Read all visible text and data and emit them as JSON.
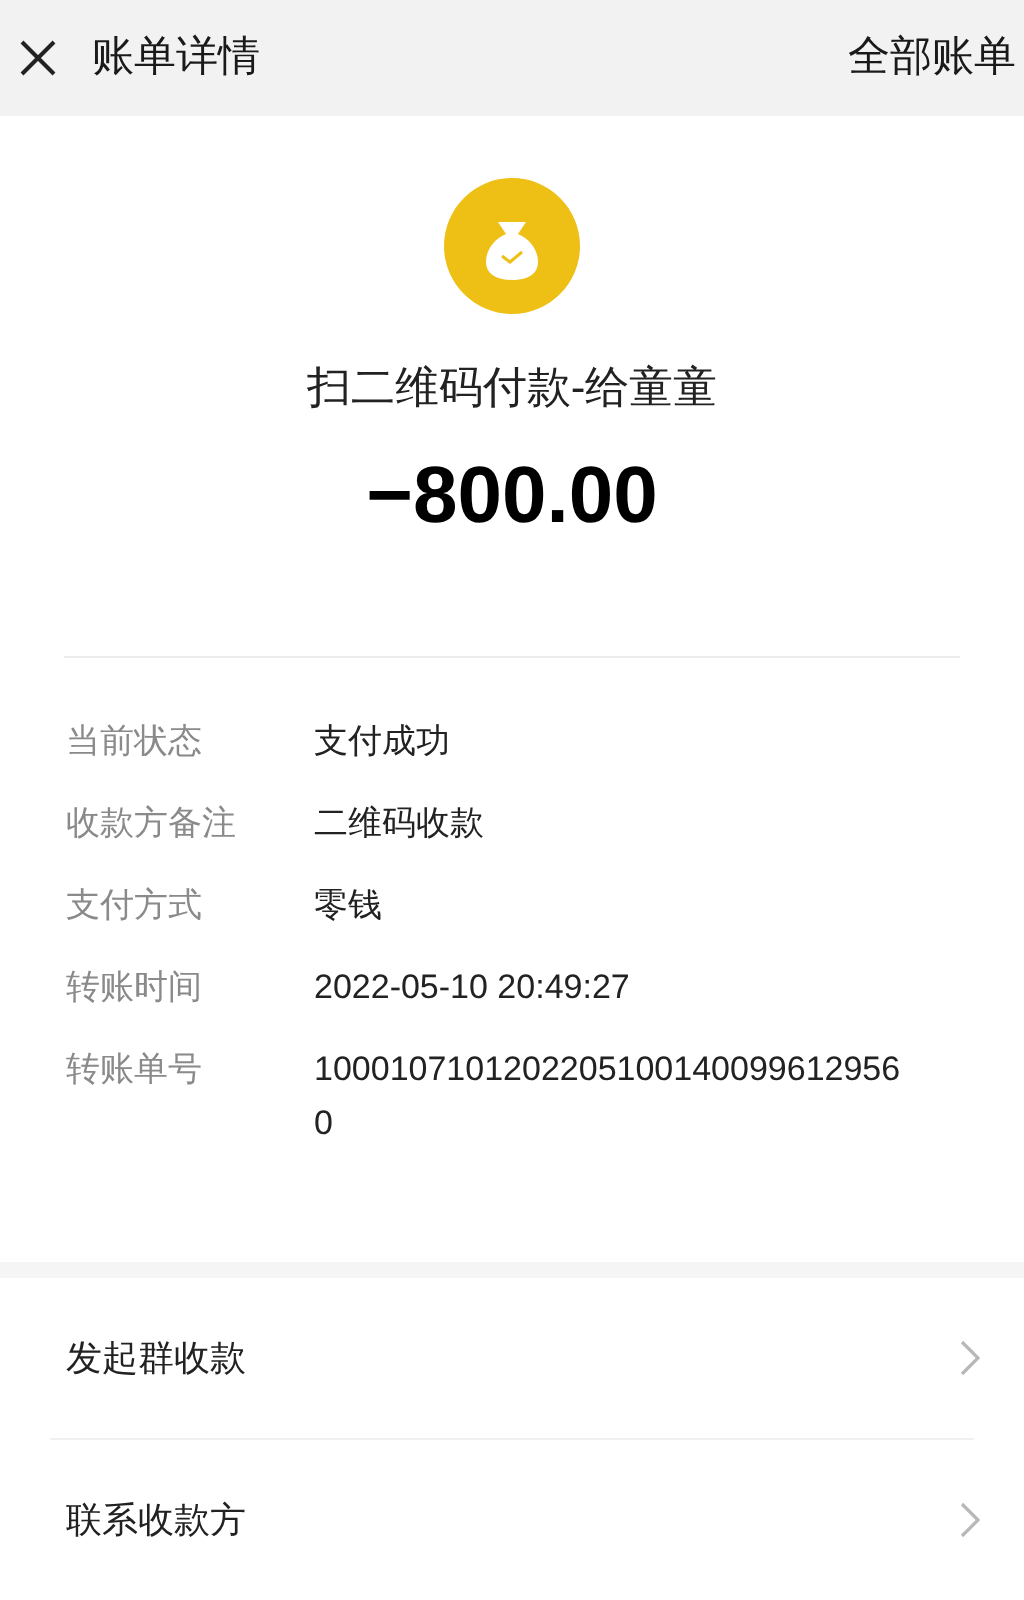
{
  "header": {
    "title": "账单详情",
    "action": "全部账单"
  },
  "summary": {
    "title": "扫二维码付款-给童童",
    "amount": "−800.00"
  },
  "details": [
    {
      "label": "当前状态",
      "value": "支付成功"
    },
    {
      "label": "收款方备注",
      "value": "二维码收款"
    },
    {
      "label": "支付方式",
      "value": "零钱"
    },
    {
      "label": "转账时间",
      "value": "2022-05-10 20:49:27"
    },
    {
      "label": "转账单号",
      "value": "10001071012022051001400996129560"
    }
  ],
  "menu": [
    {
      "label": "发起群收款"
    },
    {
      "label": "联系收款方"
    }
  ]
}
